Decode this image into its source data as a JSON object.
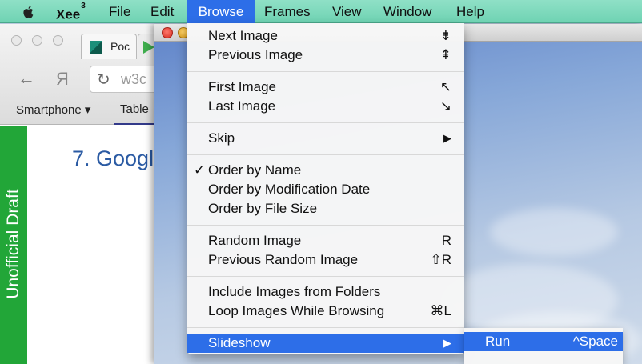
{
  "menubar": {
    "app_name": "Xee",
    "app_superscript": "3",
    "items": [
      "File",
      "Edit",
      "Browse",
      "Frames",
      "View",
      "Window",
      "Help"
    ]
  },
  "browser": {
    "tab_title": "Poc",
    "url": "w3c",
    "bookmarks": [
      "Smartphone ▾",
      "Table"
    ],
    "side_label": "Unofficial Draft",
    "heading": "7. Googl"
  },
  "browse_menu": {
    "groups": [
      [
        {
          "label": "Next Image",
          "shortcut": "⇟"
        },
        {
          "label": "Previous Image",
          "shortcut": "⇞"
        }
      ],
      [
        {
          "label": "First Image",
          "shortcut": "↖"
        },
        {
          "label": "Last Image",
          "shortcut": "↘"
        }
      ],
      [
        {
          "label": "Skip",
          "shortcut": "▶"
        }
      ],
      [
        {
          "label": "Order by Name",
          "shortcut": "",
          "checked": "✓"
        },
        {
          "label": "Order by Modification Date",
          "shortcut": ""
        },
        {
          "label": "Order by File Size",
          "shortcut": ""
        }
      ],
      [
        {
          "label": "Random Image",
          "shortcut": "R"
        },
        {
          "label": "Previous Random Image",
          "shortcut": "⇧R"
        }
      ],
      [
        {
          "label": "Include Images from Folders",
          "shortcut": ""
        },
        {
          "label": "Loop Images While Browsing",
          "shortcut": "⌘L"
        }
      ],
      [
        {
          "label": "Slideshow",
          "shortcut": "▶"
        }
      ]
    ]
  },
  "slideshow_submenu": {
    "run_label": "Run",
    "run_shortcut": "^Space"
  },
  "colors": {
    "menubar": "#7ad8bb",
    "highlight": "#2d6ee8",
    "draft_green": "#22a638",
    "heading_blue": "#2a5aa3"
  }
}
